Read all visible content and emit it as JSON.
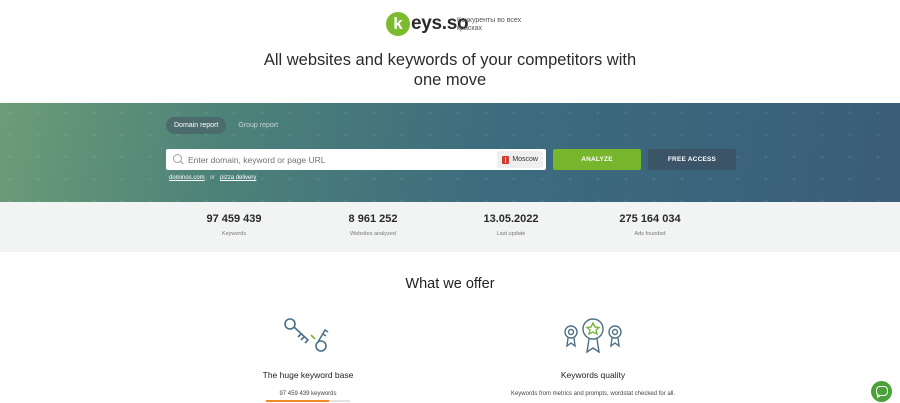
{
  "header": {
    "logo_mark": "k",
    "logo_text": "eys.so",
    "tagline": "Конкуренты во всех красках"
  },
  "headline": "All websites and keywords of your competitors with one move",
  "hero": {
    "tabs": [
      {
        "label": "Domain report",
        "active": true
      },
      {
        "label": "Group report",
        "active": false
      }
    ],
    "search": {
      "placeholder": "Enter domain, keyword or page URL",
      "value": ""
    },
    "region": "Moscow",
    "analyze_label": "ANALYZE",
    "free_access_label": "FREE ACCESS",
    "examples": {
      "first": "dominos.com",
      "or": "or",
      "second": "pizza delivery"
    },
    "colors": {
      "analyze": "#76b52c",
      "free_access": "#3c5468"
    }
  },
  "stats": [
    {
      "value": "97 459 439",
      "label": "Keywords"
    },
    {
      "value": "8 961 252",
      "label": "Websites analyzed"
    },
    {
      "value": "13.05.2022",
      "label": "Last update"
    },
    {
      "value": "275 164 034",
      "label": "Ads founded"
    }
  ],
  "offer": {
    "title": "What we offer",
    "features": [
      {
        "icon": "keys-icon",
        "title": "The huge keyword base",
        "subtitle": "97 459 439 keywords",
        "progress": 0.75
      },
      {
        "icon": "award-badges-icon",
        "title": "Keywords quality",
        "subtitle": "Keywords from metrics and prompts, wordstat checked for all."
      }
    ]
  },
  "chat": {
    "icon": "chat-icon",
    "color": "#4aa13a"
  }
}
